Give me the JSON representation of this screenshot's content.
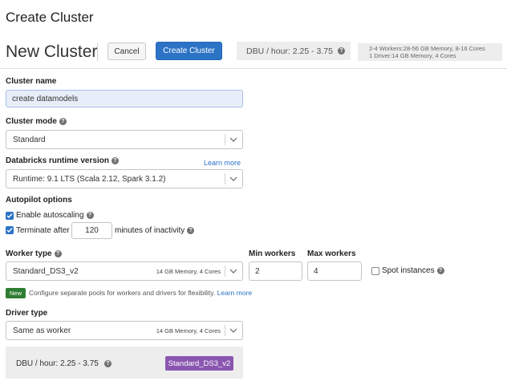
{
  "page": {
    "title": "Create Cluster"
  },
  "header": {
    "subtitle": "New Cluster",
    "cancel_label": "Cancel",
    "create_label": "Create Cluster",
    "dbu_text": "DBU / hour: 2.25 - 3.75",
    "summary_line1": "2-4 Workers:28-56 GB Memory, 8-16 Cores",
    "summary_line2": "1 Driver:14 GB Memory, 4 Cores"
  },
  "form": {
    "cluster_name_label": "Cluster name",
    "cluster_name_value": "create datamodels",
    "cluster_mode_label": "Cluster mode",
    "cluster_mode_value": "Standard",
    "runtime_label": "Databricks runtime version",
    "learn_more": "Learn more",
    "runtime_value": "Runtime: 9.1 LTS (Scala 2.12, Spark 3.1.2)",
    "autopilot_label": "Autopilot options",
    "enable_autoscaling": {
      "label": "Enable autoscaling",
      "checked": true
    },
    "terminate": {
      "label": "Terminate after",
      "checked": true,
      "value": "120",
      "suffix": "minutes of inactivity"
    },
    "worker_type_label": "Worker type",
    "worker_type_value": "Standard_DS3_v2",
    "worker_type_meta": "14 GB Memory, 4 Cores",
    "min_workers_label": "Min workers",
    "min_workers_value": "2",
    "max_workers_label": "Max workers",
    "max_workers_value": "4",
    "spot_instances": {
      "label": "Spot instances",
      "checked": false
    },
    "new_badge": "New",
    "pools_note": "Configure separate pools for workers and drivers for flexibility.",
    "pools_learn_more": "Learn more",
    "driver_type_label": "Driver type",
    "driver_type_value": "Same as worker",
    "driver_type_meta": "14 GB Memory, 4 Cores",
    "dbu_bottom": "DBU / hour: 2.25 - 3.75",
    "instance_tag": "Standard_DS3_v2"
  },
  "icons": {
    "help": "help-circle-icon",
    "chevron": "chevron-down-icon",
    "check": "checkmark-icon"
  },
  "colors": {
    "primary": "#2c73c6",
    "badge_new": "#2e7d32",
    "instance_tag": "#8a56b0",
    "filled_input": "#e8eef9"
  }
}
